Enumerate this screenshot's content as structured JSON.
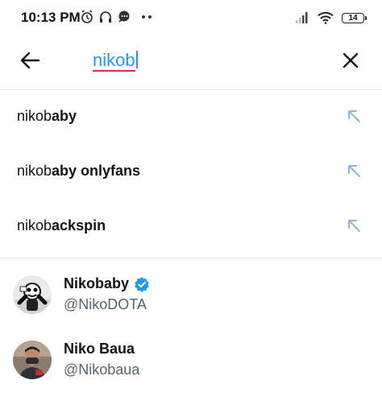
{
  "status_bar": {
    "time": "10:13 PM",
    "battery": "14",
    "icons": [
      "alarm-icon",
      "headphones-icon",
      "chat-bubble-icon",
      "more-dots-icon",
      "signal-icon",
      "wifi-icon",
      "battery-icon"
    ]
  },
  "search": {
    "query": "nikob",
    "back_icon": "arrow-left-icon",
    "clear_icon": "close-icon"
  },
  "suggestions": [
    {
      "prefix": "nikob",
      "rest": "aby",
      "icon": "arrow-up-left-icon"
    },
    {
      "prefix": "nikob",
      "rest": "aby onlyfans",
      "icon": "arrow-up-left-icon"
    },
    {
      "prefix": "nikob",
      "rest": "ackspin",
      "icon": "arrow-up-left-icon"
    }
  ],
  "users": [
    {
      "name": "Nikobaby",
      "handle": "@NikoDOTA",
      "verified": true
    },
    {
      "name": "Niko Baua",
      "handle": "@Nikobaua",
      "verified": false
    }
  ],
  "colors": {
    "accent": "#1d9bf0",
    "spellcheck_underline": "#e0245e",
    "muted_text": "#536471",
    "arrow_icon": "#8fb3d9",
    "divider": "#dfe3e6"
  }
}
